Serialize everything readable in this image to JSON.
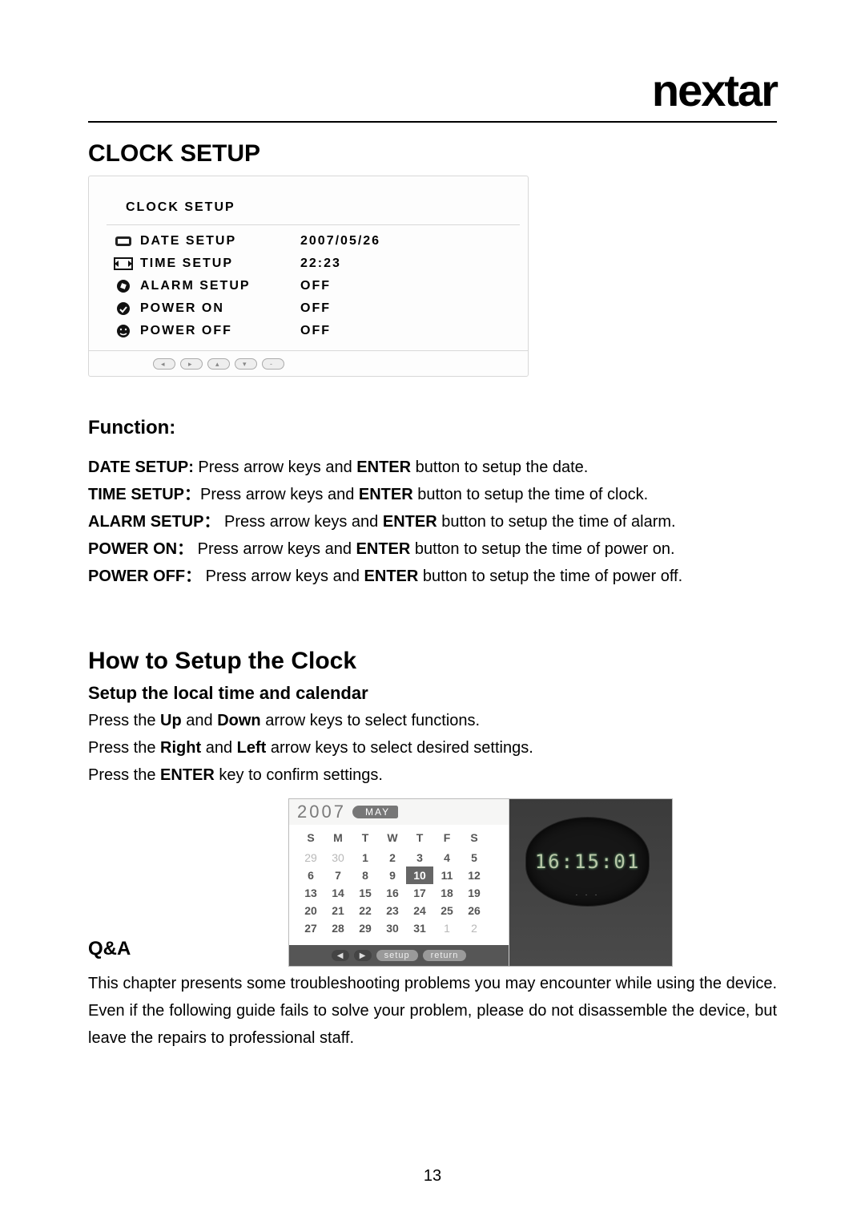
{
  "brand": "nextar",
  "sections": {
    "clock_setup_title": "CLOCK SETUP",
    "function_title": "Function:",
    "how_to_title": "How to Setup the Clock",
    "setup_subtitle": "Setup the local time and calendar",
    "qa_title": "Q&A"
  },
  "panel": {
    "title": "CLOCK SETUP",
    "rows": [
      {
        "icon": "date-icon",
        "label": "DATE SETUP",
        "value": "2007/05/26"
      },
      {
        "icon": "time-icon",
        "label": "TIME SETUP",
        "value": "22:23"
      },
      {
        "icon": "alarm-icon",
        "label": "ALARM SETUP",
        "value": "OFF"
      },
      {
        "icon": "on-icon",
        "label": "POWER ON",
        "value": "OFF"
      },
      {
        "icon": "off-icon",
        "label": "POWER OFF",
        "value": "OFF"
      }
    ],
    "footer_buttons": [
      "left",
      "right",
      "up",
      "down",
      "enter"
    ]
  },
  "function_lines": {
    "l1_b1": "DATE SETUP:",
    "l1_t1": " Press arrow keys and ",
    "l1_b2": "ENTER",
    "l1_t2": " button to setup the date.",
    "l2_b1": "TIME SETUP：",
    "l2_t1": "Press arrow keys and ",
    "l2_b2": "ENTER",
    "l2_t2": " button to setup the time of clock.",
    "l3_b1": "ALARM SETUP：",
    "l3_t1": " Press arrow keys and ",
    "l3_b2": "ENTER",
    "l3_t2": " button to setup the time of alarm.",
    "l4_b1": "POWER ON：",
    "l4_t1": " Press arrow keys and ",
    "l4_b2": "ENTER",
    "l4_t2": " button to setup the time of power on.",
    "l5_b1": "POWER OFF：",
    "l5_t1": " Press arrow keys and ",
    "l5_b2": "ENTER",
    "l5_t2": " button to setup the time of power off."
  },
  "setup_lines": {
    "l1a": "Press the ",
    "l1b1": "Up",
    "l1mid": " and ",
    "l1b2": "Down",
    "l1c": " arrow keys to select functions.",
    "l2a": "Press the ",
    "l2b1": "Right",
    "l2mid": " and ",
    "l2b2": "Left",
    "l2c": " arrow keys to select desired settings.",
    "l3a": "Press the ",
    "l3b1": "ENTER",
    "l3c": " key to confirm settings."
  },
  "calendar": {
    "year": "2007",
    "month": "MAY",
    "dow": [
      "S",
      "M",
      "T",
      "W",
      "T",
      "F",
      "S"
    ],
    "weeks": [
      [
        {
          "d": "29",
          "dim": true
        },
        {
          "d": "30",
          "dim": true
        },
        {
          "d": "1"
        },
        {
          "d": "2"
        },
        {
          "d": "3"
        },
        {
          "d": "4"
        },
        {
          "d": "5"
        }
      ],
      [
        {
          "d": "6"
        },
        {
          "d": "7"
        },
        {
          "d": "8"
        },
        {
          "d": "9"
        },
        {
          "d": "10",
          "today": true
        },
        {
          "d": "11"
        },
        {
          "d": "12"
        }
      ],
      [
        {
          "d": "13"
        },
        {
          "d": "14"
        },
        {
          "d": "15"
        },
        {
          "d": "16"
        },
        {
          "d": "17"
        },
        {
          "d": "18"
        },
        {
          "d": "19"
        }
      ],
      [
        {
          "d": "20"
        },
        {
          "d": "21"
        },
        {
          "d": "22"
        },
        {
          "d": "23"
        },
        {
          "d": "24"
        },
        {
          "d": "25"
        },
        {
          "d": "26"
        }
      ],
      [
        {
          "d": "27"
        },
        {
          "d": "28"
        },
        {
          "d": "29"
        },
        {
          "d": "30"
        },
        {
          "d": "31"
        },
        {
          "d": "1",
          "dim": true
        },
        {
          "d": "2",
          "dim": true
        }
      ]
    ],
    "footer": {
      "setup": "setup",
      "return": "return"
    },
    "clock_text": "16:15:01"
  },
  "qa_body": "This chapter presents some troubleshooting problems you may encounter while using the device. Even if the following guide fails to solve your problem, please do not disassemble the device, but leave the repairs to professional staff.",
  "page_number": "13"
}
